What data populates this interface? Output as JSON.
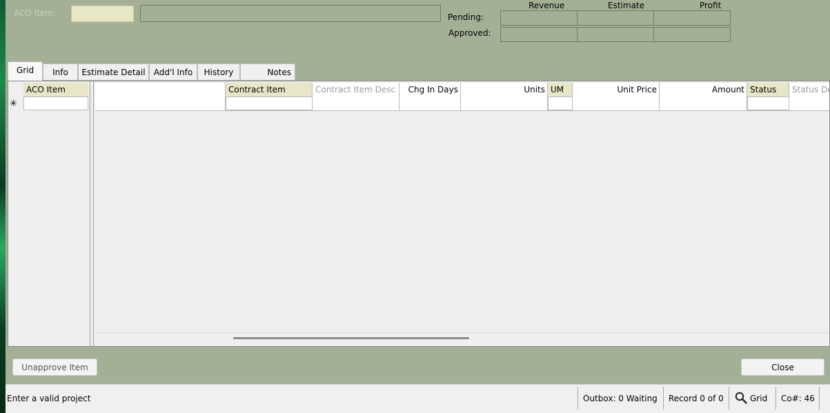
{
  "header": {
    "aco_item_label": "ACO Item:",
    "aco_item_value": "",
    "description_value": "",
    "columns": [
      "Revenue",
      "Estimate",
      "Profit"
    ],
    "rows": [
      {
        "label": "Pending:",
        "values": [
          "",
          "",
          ""
        ]
      },
      {
        "label": "Approved:",
        "values": [
          "",
          "",
          ""
        ]
      }
    ]
  },
  "tabs": [
    {
      "label": "Grid",
      "active": true
    },
    {
      "label": "Info",
      "active": false
    },
    {
      "label": "Estimate Detail",
      "active": false
    },
    {
      "label": "Add'l Info",
      "active": false
    },
    {
      "label": "History",
      "active": false
    },
    {
      "label": "Notes",
      "active": false
    }
  ],
  "grid": {
    "left_column": "ACO Item",
    "new_row_marker": "✳",
    "columns": [
      {
        "label": "Contract Item",
        "key": true
      },
      {
        "label": "Contract Item Desc",
        "disabled": true
      },
      {
        "label": "Chg In Days"
      },
      {
        "label": "Units"
      },
      {
        "label": "UM",
        "key": true
      },
      {
        "label": "Unit Price"
      },
      {
        "label": "Amount"
      },
      {
        "label": "Status",
        "key": true
      },
      {
        "label": "Status De",
        "disabled": true
      }
    ]
  },
  "buttons": {
    "unapprove": "Unapprove Item",
    "close": "Close"
  },
  "status_bar": {
    "message": "Enter a valid project",
    "outbox": "Outbox: 0 Waiting",
    "record": "Record 0 of 0",
    "view": "Grid",
    "company": "Co#: 46"
  },
  "icons": {
    "search": "magnifier-icon",
    "new_row": "asterisk-icon"
  },
  "colors": {
    "window_bg": "#a3b095",
    "key_field_bg": "#e7e6c6"
  }
}
